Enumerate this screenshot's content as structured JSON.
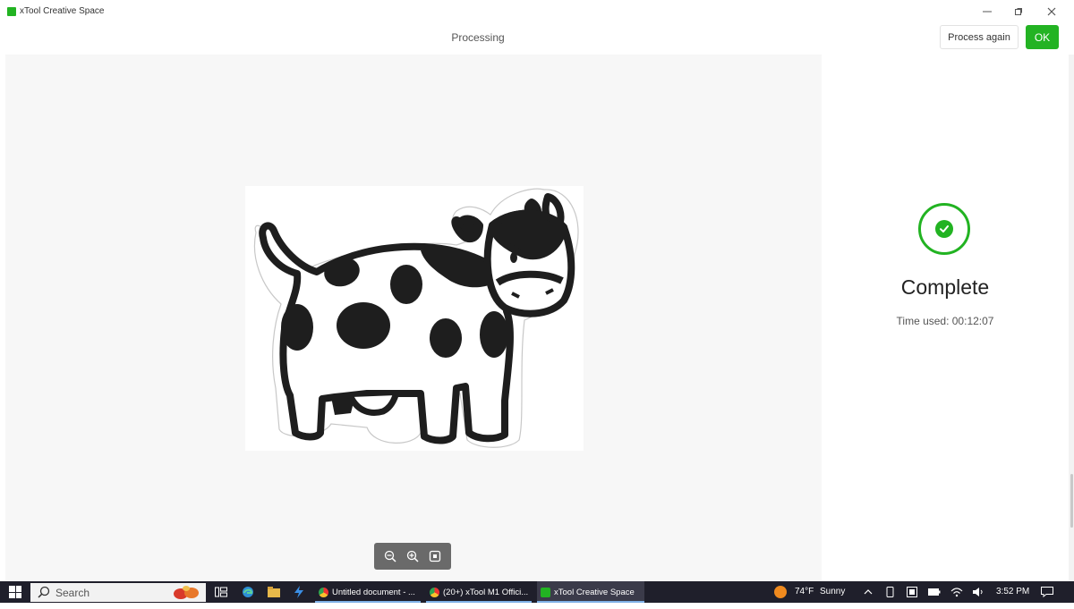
{
  "window": {
    "title": "xTool Creative Space",
    "icons": [
      "app-icon",
      "minimize-icon",
      "maximize-icon",
      "close-icon"
    ]
  },
  "header": {
    "title": "Processing",
    "process_again_label": "Process again",
    "ok_label": "OK"
  },
  "canvas": {
    "image_subject": "cow-sticker",
    "zoom_controls": [
      "zoom-out-icon",
      "zoom-in-icon",
      "fit-to-screen-icon"
    ]
  },
  "status": {
    "icon": "check-circle-icon",
    "heading": "Complete",
    "time_used_label": "Time used: 00:12:07"
  },
  "taskbar": {
    "search_placeholder": "Search",
    "apps": [
      {
        "label": "Untitled document - ...",
        "icon": "chrome-icon"
      },
      {
        "label": "(20+) xTool M1 Offici...",
        "icon": "chrome-icon"
      },
      {
        "label": "xTool Creative Space",
        "icon": "xtool-icon",
        "active": true
      }
    ],
    "weather_temp": "74°F",
    "weather_text": "Sunny",
    "clock": "3:52 PM"
  },
  "colors": {
    "accent": "#23b323",
    "taskbar": "#1f1f2b",
    "canvas_bg": "#f7f7f7"
  }
}
